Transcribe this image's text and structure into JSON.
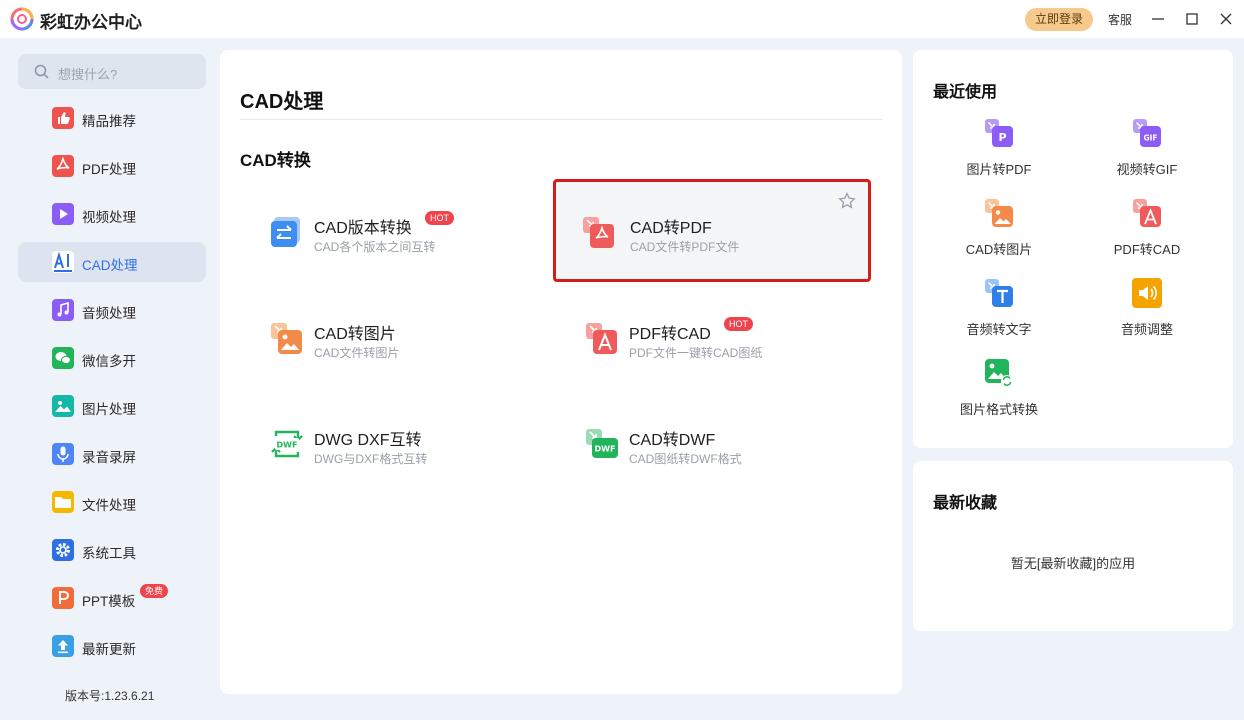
{
  "app": {
    "title": "彩虹办公中心",
    "login_label": "立即登录",
    "service_label": "客服"
  },
  "sidebar": {
    "search_placeholder": "想搜什么?",
    "items": [
      {
        "label": "精品推荐",
        "icon": "thumbs-up-icon",
        "color": "#ef5350",
        "active": false
      },
      {
        "label": "PDF处理",
        "icon": "pdf-icon",
        "color": "#ef5350",
        "active": false
      },
      {
        "label": "视频处理",
        "icon": "video-play-icon",
        "color": "#8b5cf6",
        "active": false
      },
      {
        "label": "CAD处理",
        "icon": "cad-icon",
        "color": "#2f6fe5",
        "active": true
      },
      {
        "label": "音频处理",
        "icon": "music-note-icon",
        "color": "#8b5cf6",
        "active": false
      },
      {
        "label": "微信多开",
        "icon": "wechat-icon",
        "color": "#22b45a",
        "active": false
      },
      {
        "label": "图片处理",
        "icon": "image-icon",
        "color": "#14b8a6",
        "active": false
      },
      {
        "label": "录音录屏",
        "icon": "microphone-icon",
        "color": "#4f86f7",
        "active": false
      },
      {
        "label": "文件处理",
        "icon": "folder-icon",
        "color": "#f5b800",
        "active": false
      },
      {
        "label": "系统工具",
        "icon": "gear-icon",
        "color": "#2f6fe5",
        "active": false
      },
      {
        "label": "PPT模板",
        "icon": "ppt-icon",
        "color": "#f26b3a",
        "active": false,
        "badge": "免费"
      },
      {
        "label": "最新更新",
        "icon": "upload-arrow-icon",
        "color": "#3aa0e6",
        "active": false
      }
    ],
    "version": "版本号:1.23.6.21"
  },
  "main": {
    "title": "CAD处理",
    "section_title": "CAD转换",
    "tools": [
      {
        "name": "CAD版本转换",
        "desc": "CAD各个版本之间互转",
        "badge": "HOT",
        "icon": "swap-arrows-icon",
        "highlight": false
      },
      {
        "name": "CAD转PDF",
        "desc": "CAD文件转PDF文件",
        "badge": "",
        "icon": "cad-to-pdf-icon",
        "highlight": true
      },
      {
        "name": "CAD转图片",
        "desc": "CAD文件转图片",
        "badge": "",
        "icon": "cad-to-image-icon",
        "highlight": false
      },
      {
        "name": "PDF转CAD",
        "desc": "PDF文件一键转CAD图纸",
        "badge": "HOT",
        "icon": "pdf-to-cad-icon",
        "highlight": false
      },
      {
        "name": "DWG DXF互转",
        "desc": "DWG与DXF格式互转",
        "badge": "",
        "icon": "dwf-cycle-icon",
        "highlight": false
      },
      {
        "name": "CAD转DWF",
        "desc": "CAD图纸转DWF格式",
        "badge": "",
        "icon": "cad-to-dwf-icon",
        "highlight": false
      }
    ]
  },
  "recent": {
    "title": "最近使用",
    "items": [
      {
        "label": "图片转PDF",
        "icon": "image-to-pdf-icon"
      },
      {
        "label": "视频转GIF",
        "icon": "video-to-gif-icon"
      },
      {
        "label": "CAD转图片",
        "icon": "cad-to-image-icon"
      },
      {
        "label": "PDF转CAD",
        "icon": "pdf-to-cad-icon"
      },
      {
        "label": "音频转文字",
        "icon": "audio-to-text-icon"
      },
      {
        "label": "音频调整",
        "icon": "speaker-icon"
      },
      {
        "label": "图片格式转换",
        "icon": "image-format-icon"
      }
    ]
  },
  "favorites": {
    "title": "最新收藏",
    "empty_text": "暂无[最新收藏]的应用"
  },
  "colors": {
    "accent": "#2f6fe5",
    "highlight_border": "#d71b1b",
    "hot": "#f0444c",
    "login": "#f6c98c"
  }
}
